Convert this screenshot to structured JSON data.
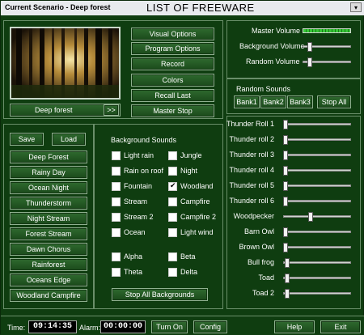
{
  "title": {
    "scenario": "Current Scenario - Deep forest",
    "banner": "LIST OF FREEWARE",
    "dropdown": "▾"
  },
  "scene": {
    "name": "Deep forest",
    "next": ">>"
  },
  "options": [
    "Visual Options",
    "Program Options",
    "Record",
    "Colors",
    "Recall Last",
    "Master Stop"
  ],
  "scenario_list": {
    "save": "Save",
    "load": "Load",
    "items": [
      "Deep Forest",
      "Rainy Day",
      "Ocean Night",
      "Thunderstorm",
      "Night Stream",
      "Forest Stream",
      "Dawn Chorus",
      "Rainforest",
      "Oceans Edge",
      "Woodland Campfire"
    ]
  },
  "background": {
    "heading": "Background Sounds",
    "left": [
      {
        "label": "Light rain",
        "checked": false
      },
      {
        "label": "Rain on roof",
        "checked": false
      },
      {
        "label": "Fountain",
        "checked": false
      },
      {
        "label": "Stream",
        "checked": false
      },
      {
        "label": "Stream 2",
        "checked": false
      },
      {
        "label": "Ocean",
        "checked": false
      }
    ],
    "right": [
      {
        "label": "Jungle",
        "checked": false
      },
      {
        "label": "Night",
        "checked": false
      },
      {
        "label": "Woodland",
        "checked": true
      },
      {
        "label": "Campfire",
        "checked": false
      },
      {
        "label": "Campfire 2",
        "checked": false
      },
      {
        "label": "Light wind",
        "checked": false
      }
    ],
    "waves_left": [
      {
        "label": "Alpha",
        "checked": false
      },
      {
        "label": "Theta",
        "checked": false
      }
    ],
    "waves_right": [
      {
        "label": "Beta",
        "checked": false
      },
      {
        "label": "Delta",
        "checked": false
      }
    ],
    "stop_all": "Stop All Backgrounds"
  },
  "volumes": [
    {
      "label": "Master Volume",
      "value": 1.0
    },
    {
      "label": "Background Volume",
      "value": 0.12
    },
    {
      "label": "Random Volume",
      "value": 0.12
    }
  ],
  "random": {
    "heading": "Random Sounds",
    "banks": [
      "Bank1",
      "Bank2",
      "Bank3"
    ],
    "stop_all": "Stop All",
    "sliders": [
      {
        "label": "Thunder Roll 1",
        "value": 0.0
      },
      {
        "label": "Thunder roll 2",
        "value": 0.0
      },
      {
        "label": "Thunder roll 3",
        "value": 0.0
      },
      {
        "label": "Thunder roll 4",
        "value": 0.0
      },
      {
        "label": "Thunder roll 5",
        "value": 0.0
      },
      {
        "label": "Thunder roll 6",
        "value": 0.0
      },
      {
        "label": "Woodpecker",
        "value": 0.4
      },
      {
        "label": "Barn Owl",
        "value": 0.0
      },
      {
        "label": "Brown Owl",
        "value": 0.0
      },
      {
        "label": "Bull frog",
        "value": 0.03
      },
      {
        "label": "Toad",
        "value": 0.03
      },
      {
        "label": "Toad 2",
        "value": 0.03
      }
    ]
  },
  "status": {
    "time_label": "Time:",
    "time": "09:14:35",
    "alarm_label": "Alarm:",
    "alarm": "00:00:00",
    "turn_on": "Turn On",
    "config": "Config",
    "help": "Help",
    "exit": "Exit"
  }
}
